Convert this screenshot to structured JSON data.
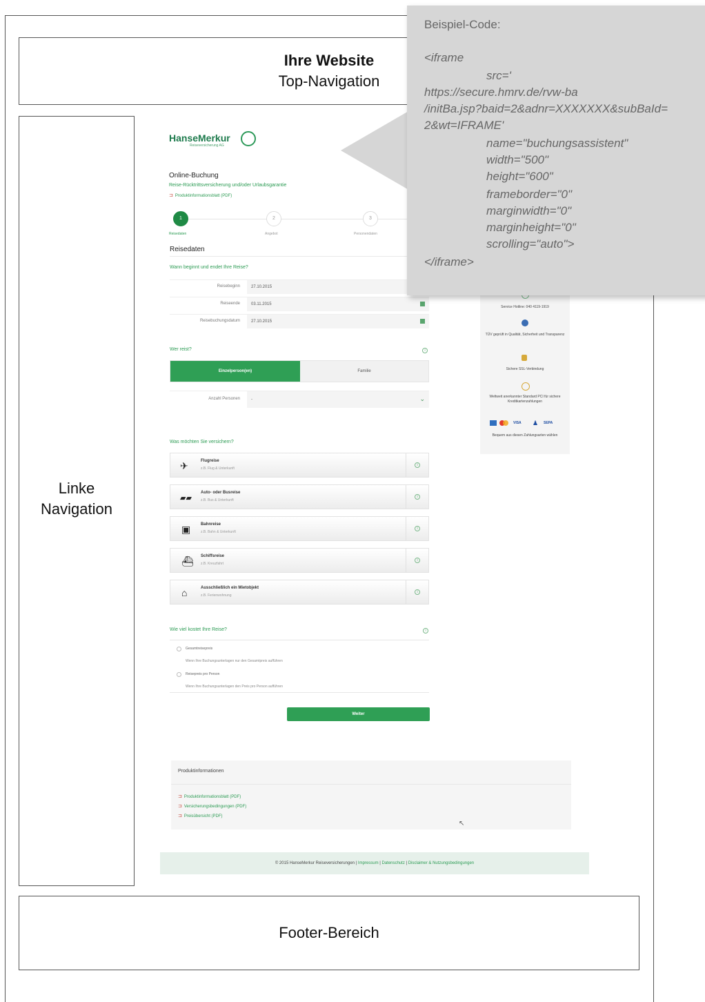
{
  "layout": {
    "top_navigation": {
      "title": "Ihre Website",
      "subtitle": "Top-Navigation"
    },
    "left_navigation": {
      "line1": "Linke",
      "line2": "Navigation"
    },
    "footer": {
      "label": "Footer-Bereich"
    }
  },
  "callout": {
    "header": "Beispiel-Code:",
    "code_lines": [
      "<iframe",
      "src='",
      "https://secure.hmrv.de/rvw-ba",
      "/initBa.jsp?baid=2&adnr=XXXXXXX&subBaId=",
      "2&wt=IFRAME'",
      "name=\"buchungsassistent\"",
      "width=\"500\"",
      "height=\"600\"",
      "frameborder=\"0\"",
      "marginwidth=\"0\"",
      "marginheight=\"0\"",
      "scrolling=\"auto\">",
      "</iframe>"
    ]
  },
  "widget": {
    "logo": {
      "name": "HanseMerkur",
      "sub": "Reiseversicherung AG"
    },
    "heading": "Online-Buchung",
    "subheading": "Reise-Rücktrittsversicherung und/oder Urlaubsgarantie",
    "pdf_link": "Produktinformationsblatt (PDF)",
    "steps": [
      {
        "num": "1",
        "label": "Reisedaten"
      },
      {
        "num": "2",
        "label": "Angebot"
      },
      {
        "num": "3",
        "label": "Personendaten"
      }
    ],
    "section": "Reisedaten",
    "q_when": "Wann beginnt und endet Ihre Reise?",
    "date_rows": [
      {
        "label": "Reisebeginn",
        "value": "27.10.2015"
      },
      {
        "label": "Reiseende",
        "value": "03.11.2015"
      },
      {
        "label": "Reisebuchungsdatum",
        "value": "27.10.2015"
      }
    ],
    "q_who": "Wer reist?",
    "segment": {
      "active": "Einzelperson(en)",
      "inactive": "Familie"
    },
    "persons": {
      "label": "Anzahl Personen",
      "value": "-"
    },
    "q_what": "Was möchten Sie versichern?",
    "insurance": [
      {
        "icon": "plane",
        "title": "Flugreise",
        "sub": "z.B. Flug & Unterkunft"
      },
      {
        "icon": "car-bus",
        "title": "Auto- oder Busreise",
        "sub": "z.B. Bus & Unterkunft"
      },
      {
        "icon": "train",
        "title": "Bahnreise",
        "sub": "z.B. Bahn & Unterkunft"
      },
      {
        "icon": "ship",
        "title": "Schiffsreise",
        "sub": "z.B. Kreuzfahrt"
      },
      {
        "icon": "house",
        "title": "Ausschließlich ein Mietobjekt",
        "sub": "z.B. Ferienwohnung"
      }
    ],
    "q_cost": "Wie viel kostet Ihre Reise?",
    "price_options": [
      {
        "label": "Gesamtreisepreis",
        "hint": "Wenn Ihre Buchungsunterlagen nur den Gesamtpreis aufführen"
      },
      {
        "label": "Reisepreis pro Person",
        "hint": "Wenn Ihre Buchungsunterlagen den Preis pro Person aufführen"
      }
    ],
    "next_button": "Weiter",
    "product_info": {
      "title": "Produktinformationen",
      "links": [
        "Produktinformationsblatt (PDF)",
        "Versicherungsbedingungen (PDF)",
        "Preisübersicht (PDF)"
      ]
    },
    "footer_bar": {
      "copyright": "© 2015 HanseMerkur Reiseversicherungen",
      "links": [
        "Impressum",
        "Datenschutz",
        "Disclaimer & Nutzungsbedingungen"
      ]
    },
    "side_panel": {
      "hotline": "Service Hotline: 040 4119-1919",
      "tuev": "TÜV geprüft in Qualität, Sicherheit und Transparenz",
      "ssl": "Sichere SSL-Verbindung",
      "pci": "Weltweit anerkannter Standard PCI für sichere Kreditkartenzahlungen",
      "payment": "Bequem aus diesen Zahlungsarten wählen",
      "pay_marks": [
        "VISA",
        "SEPA"
      ]
    }
  }
}
